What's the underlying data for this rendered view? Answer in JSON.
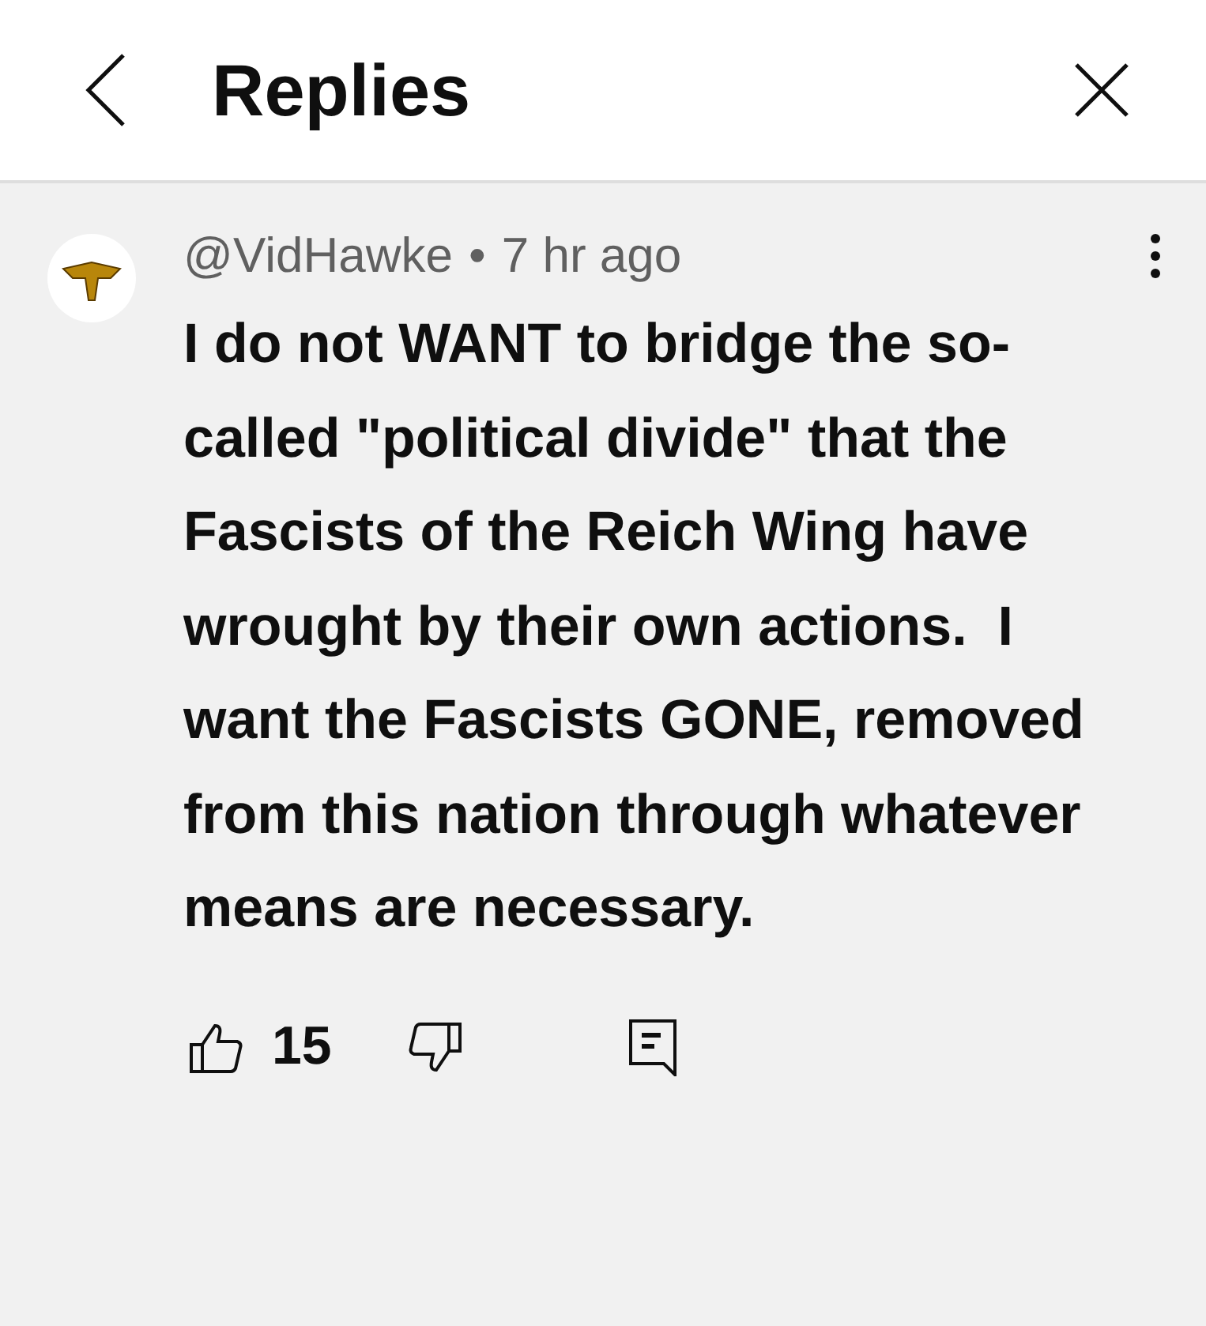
{
  "header": {
    "title": "Replies"
  },
  "comment": {
    "author": "@VidHawke",
    "separator": "•",
    "time": "7 hr ago",
    "text": "I do not WANT to bridge the so-called \"political divide\" that the Fascists of the Reich Wing have wrought by their own actions.  I want the Fascists GONE, removed from this nation through whatever means are necessary.",
    "likes": "15"
  }
}
